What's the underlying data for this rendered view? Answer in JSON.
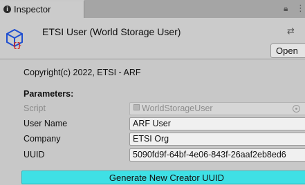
{
  "tab": {
    "label": "Inspector"
  },
  "component": {
    "title": "ETSI User (World Storage User)",
    "open_label": "Open"
  },
  "content": {
    "copyright": "Copyright(c) 2022, ETSI - ARF",
    "parameters_heading": "Parameters:",
    "fields": {
      "script": {
        "label": "Script",
        "value": "WorldStorageUser"
      },
      "user_name": {
        "label": "User Name",
        "value": "ARF User"
      },
      "company": {
        "label": "Company",
        "value": "ETSI Org"
      },
      "uuid": {
        "label": "UUID",
        "value": "5090fd9f-64bf-4e06-843f-26aaf2eb8ed6"
      }
    },
    "generate_label": "Generate New Creator UUID"
  },
  "colors": {
    "accent_button": "#3fe0e5",
    "icon_red": "#d01f1f",
    "icon_blue": "#1f4fd0"
  },
  "icons": [
    "info-icon",
    "lock-icon",
    "menu-icon",
    "script-asset-icon",
    "preset-icon",
    "object-picker-icon"
  ]
}
